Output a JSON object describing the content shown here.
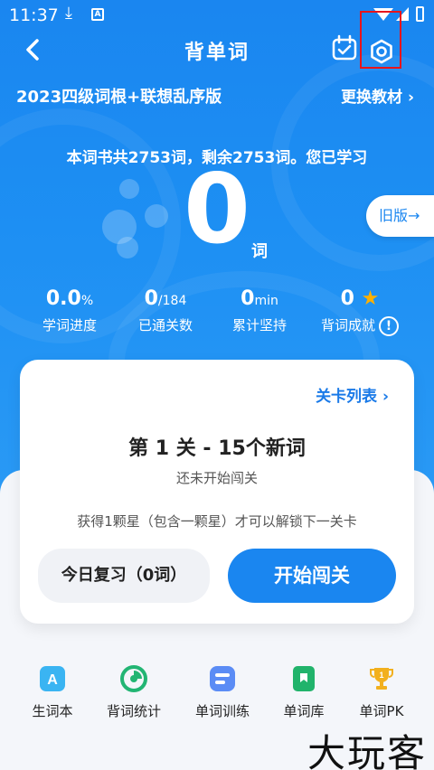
{
  "statusbar": {
    "time": "11:37"
  },
  "header": {
    "title": "背单词"
  },
  "book": {
    "name": "2023四级词根+联想乱序版",
    "change_label": "更换教材 ›"
  },
  "progress": {
    "summary": "本词书共2753词，剩余2753词。您已学习",
    "learned_count": "0",
    "learned_unit": "词",
    "old_version": "旧版→"
  },
  "stats": {
    "progress_value": "0.0",
    "progress_unit": "%",
    "progress_label": "学词进度",
    "levels_value": "0",
    "levels_unit": "/184",
    "levels_label": "已通关数",
    "minutes_value": "0",
    "minutes_unit": "min",
    "minutes_label": "累计坚持",
    "stars_value": "0",
    "stars_label": "背词成就",
    "info_glyph": "!"
  },
  "card": {
    "level_list_label": "关卡列表 ›",
    "level_title": "第 1 关 - 15个新词",
    "level_status": "还未开始闯关",
    "unlock_tip": "获得1颗星（包含一颗星）才可以解锁下一关卡",
    "review_label": "今日复习（0词）",
    "start_label": "开始闯关"
  },
  "tabs": [
    {
      "label": "生词本",
      "icon": "vocab-book-icon",
      "color": "#3ab4f2"
    },
    {
      "label": "背词统计",
      "icon": "statistics-icon",
      "color": "#22b573"
    },
    {
      "label": "单词训练",
      "icon": "training-icon",
      "color": "#5b8cf5"
    },
    {
      "label": "单词库",
      "icon": "word-library-icon",
      "color": "#21b36b"
    },
    {
      "label": "单词PK",
      "icon": "trophy-icon",
      "color": "#f2b01e"
    }
  ],
  "watermark": "大玩客",
  "colors": {
    "primary": "#1a86f0",
    "highlight": "#e8141b",
    "star": "#ffb000"
  }
}
